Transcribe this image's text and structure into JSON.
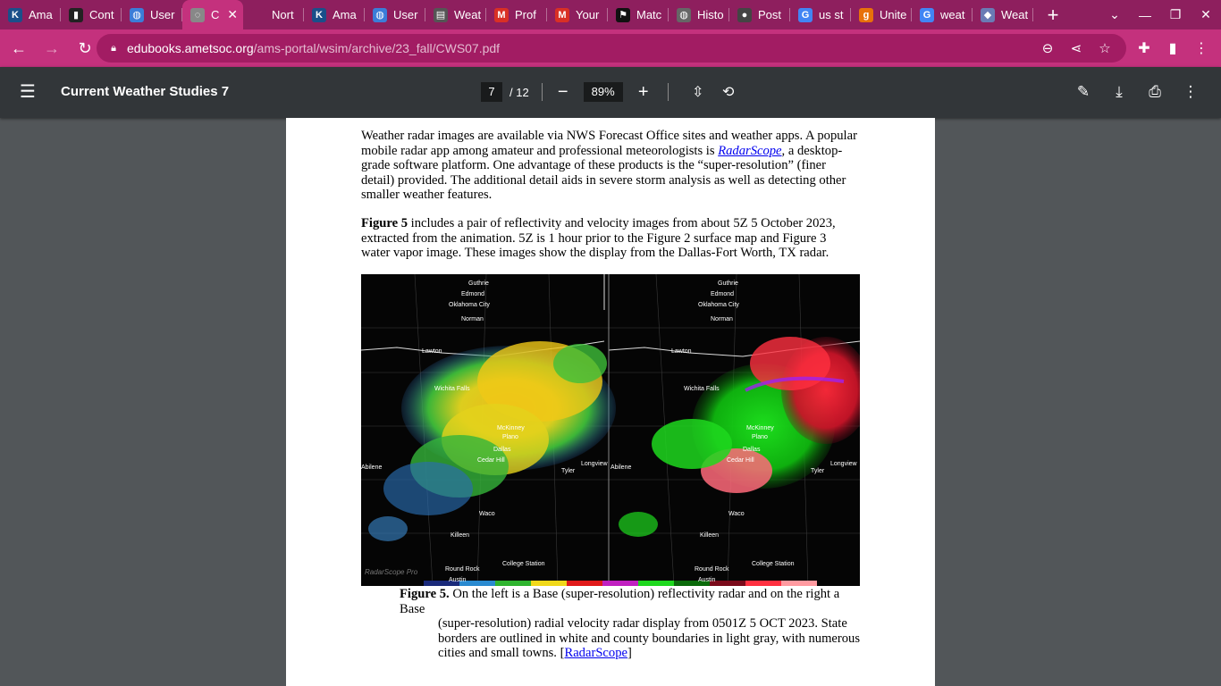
{
  "tabs": [
    {
      "title": "Ama",
      "icon": "ams-logo-icon",
      "color": "#1a4f8a"
    },
    {
      "title": "Cont",
      "icon": "bar-chart-icon",
      "color": "#222222"
    },
    {
      "title": "User",
      "icon": "globe-icon",
      "color": "#3b7dd8"
    },
    {
      "title": "C",
      "icon": "loading-icon",
      "color": "#888888"
    },
    {
      "title": "Nort",
      "icon": "blank-icon",
      "color": "#8e1f5e"
    },
    {
      "title": "Ama",
      "icon": "ams-logo-icon",
      "color": "#1a4f8a"
    },
    {
      "title": "User",
      "icon": "globe-icon",
      "color": "#3b7dd8"
    },
    {
      "title": "Weat",
      "icon": "document-icon",
      "color": "#555555"
    },
    {
      "title": "Prof",
      "icon": "gmail-icon",
      "color": "#d93025"
    },
    {
      "title": "Your",
      "icon": "gmail-icon",
      "color": "#d93025"
    },
    {
      "title": "Matc",
      "icon": "flag-icon",
      "color": "#111111"
    },
    {
      "title": "Histo",
      "icon": "globe-icon",
      "color": "#666666"
    },
    {
      "title": "Post",
      "icon": "pin-icon",
      "color": "#444444"
    },
    {
      "title": "us st",
      "icon": "google-icon",
      "color": "#4285f4"
    },
    {
      "title": "Unite",
      "icon": "g-icon",
      "color": "#e8710a"
    },
    {
      "title": "weat",
      "icon": "google-icon",
      "color": "#4285f4"
    },
    {
      "title": "Weat",
      "icon": "drop-icon",
      "color": "#6a7bb5"
    }
  ],
  "address": {
    "host": "edubooks.ametsoc.org",
    "path": "/ams-portal/wsim/archive/23_fall/CWS07.pdf"
  },
  "pdf": {
    "title": "Current Weather Studies 7",
    "page_current": "7",
    "page_total": "/ 12",
    "zoom": "89%"
  },
  "document": {
    "para1_a": "Weather radar images are available via NWS Forecast Office sites and weather apps. A popular mobile radar app among amateur and professional meteorologists is ",
    "para1_link": "RadarScope",
    "para1_b": ", a desktop-grade software platform. One advantage of these products is the “super-resolution” (finer detail) provided. The additional detail aids in severe storm analysis as well as detecting other smaller weather features.",
    "para2_bold": "Figure 5",
    "para2_text": " includes a pair of reflectivity and velocity images from about 5Z 5 October 2023, extracted from the animation. 5Z is 1 hour prior to the Figure 2 surface map and Figure 3 water vapor image. These images show the display from the Dallas-Fort Worth, TX radar.",
    "caption_bold": "Figure 5.",
    "caption_line1": " On the left is a Base (super-resolution) reflectivity radar and on the right a Base",
    "caption_rest": "(super-resolution) radial velocity radar display from 0501Z 5 OCT 2023. State borders are outlined in white and county boundaries in light gray, with numerous cities and small towns. [",
    "caption_link": "RadarScope",
    "caption_end": "]"
  },
  "figure": {
    "watermark": "RadarScope Pro",
    "cities": [
      "Guthrie",
      "Edmond",
      "Oklahoma City",
      "Norman",
      "Lawton",
      "Wichita Falls",
      "McKinney",
      "Plano",
      "Dallas",
      "Cedar Hill",
      "Abilene",
      "Tyler",
      "Longview",
      "Waco",
      "Killeen",
      "College Station",
      "Round Rock",
      "Austin"
    ]
  },
  "colors": {
    "tabstrip": "#8e1f5e",
    "toolbar": "#c4317d",
    "pdfbar": "#323639",
    "viewer_bg": "#525659"
  }
}
